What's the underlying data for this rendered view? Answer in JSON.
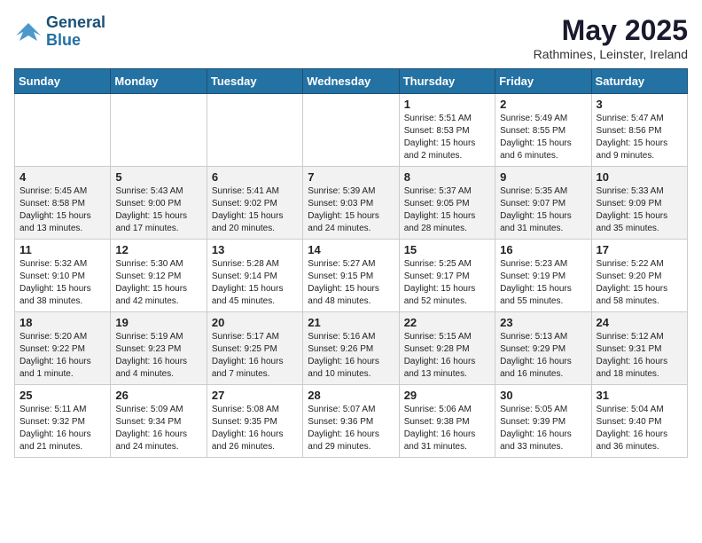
{
  "header": {
    "logo_line1": "General",
    "logo_line2": "Blue",
    "month_title": "May 2025",
    "location": "Rathmines, Leinster, Ireland"
  },
  "weekdays": [
    "Sunday",
    "Monday",
    "Tuesday",
    "Wednesday",
    "Thursday",
    "Friday",
    "Saturday"
  ],
  "weeks": [
    [
      {
        "day": "",
        "info": ""
      },
      {
        "day": "",
        "info": ""
      },
      {
        "day": "",
        "info": ""
      },
      {
        "day": "",
        "info": ""
      },
      {
        "day": "1",
        "info": "Sunrise: 5:51 AM\nSunset: 8:53 PM\nDaylight: 15 hours\nand 2 minutes."
      },
      {
        "day": "2",
        "info": "Sunrise: 5:49 AM\nSunset: 8:55 PM\nDaylight: 15 hours\nand 6 minutes."
      },
      {
        "day": "3",
        "info": "Sunrise: 5:47 AM\nSunset: 8:56 PM\nDaylight: 15 hours\nand 9 minutes."
      }
    ],
    [
      {
        "day": "4",
        "info": "Sunrise: 5:45 AM\nSunset: 8:58 PM\nDaylight: 15 hours\nand 13 minutes."
      },
      {
        "day": "5",
        "info": "Sunrise: 5:43 AM\nSunset: 9:00 PM\nDaylight: 15 hours\nand 17 minutes."
      },
      {
        "day": "6",
        "info": "Sunrise: 5:41 AM\nSunset: 9:02 PM\nDaylight: 15 hours\nand 20 minutes."
      },
      {
        "day": "7",
        "info": "Sunrise: 5:39 AM\nSunset: 9:03 PM\nDaylight: 15 hours\nand 24 minutes."
      },
      {
        "day": "8",
        "info": "Sunrise: 5:37 AM\nSunset: 9:05 PM\nDaylight: 15 hours\nand 28 minutes."
      },
      {
        "day": "9",
        "info": "Sunrise: 5:35 AM\nSunset: 9:07 PM\nDaylight: 15 hours\nand 31 minutes."
      },
      {
        "day": "10",
        "info": "Sunrise: 5:33 AM\nSunset: 9:09 PM\nDaylight: 15 hours\nand 35 minutes."
      }
    ],
    [
      {
        "day": "11",
        "info": "Sunrise: 5:32 AM\nSunset: 9:10 PM\nDaylight: 15 hours\nand 38 minutes."
      },
      {
        "day": "12",
        "info": "Sunrise: 5:30 AM\nSunset: 9:12 PM\nDaylight: 15 hours\nand 42 minutes."
      },
      {
        "day": "13",
        "info": "Sunrise: 5:28 AM\nSunset: 9:14 PM\nDaylight: 15 hours\nand 45 minutes."
      },
      {
        "day": "14",
        "info": "Sunrise: 5:27 AM\nSunset: 9:15 PM\nDaylight: 15 hours\nand 48 minutes."
      },
      {
        "day": "15",
        "info": "Sunrise: 5:25 AM\nSunset: 9:17 PM\nDaylight: 15 hours\nand 52 minutes."
      },
      {
        "day": "16",
        "info": "Sunrise: 5:23 AM\nSunset: 9:19 PM\nDaylight: 15 hours\nand 55 minutes."
      },
      {
        "day": "17",
        "info": "Sunrise: 5:22 AM\nSunset: 9:20 PM\nDaylight: 15 hours\nand 58 minutes."
      }
    ],
    [
      {
        "day": "18",
        "info": "Sunrise: 5:20 AM\nSunset: 9:22 PM\nDaylight: 16 hours\nand 1 minute."
      },
      {
        "day": "19",
        "info": "Sunrise: 5:19 AM\nSunset: 9:23 PM\nDaylight: 16 hours\nand 4 minutes."
      },
      {
        "day": "20",
        "info": "Sunrise: 5:17 AM\nSunset: 9:25 PM\nDaylight: 16 hours\nand 7 minutes."
      },
      {
        "day": "21",
        "info": "Sunrise: 5:16 AM\nSunset: 9:26 PM\nDaylight: 16 hours\nand 10 minutes."
      },
      {
        "day": "22",
        "info": "Sunrise: 5:15 AM\nSunset: 9:28 PM\nDaylight: 16 hours\nand 13 minutes."
      },
      {
        "day": "23",
        "info": "Sunrise: 5:13 AM\nSunset: 9:29 PM\nDaylight: 16 hours\nand 16 minutes."
      },
      {
        "day": "24",
        "info": "Sunrise: 5:12 AM\nSunset: 9:31 PM\nDaylight: 16 hours\nand 18 minutes."
      }
    ],
    [
      {
        "day": "25",
        "info": "Sunrise: 5:11 AM\nSunset: 9:32 PM\nDaylight: 16 hours\nand 21 minutes."
      },
      {
        "day": "26",
        "info": "Sunrise: 5:09 AM\nSunset: 9:34 PM\nDaylight: 16 hours\nand 24 minutes."
      },
      {
        "day": "27",
        "info": "Sunrise: 5:08 AM\nSunset: 9:35 PM\nDaylight: 16 hours\nand 26 minutes."
      },
      {
        "day": "28",
        "info": "Sunrise: 5:07 AM\nSunset: 9:36 PM\nDaylight: 16 hours\nand 29 minutes."
      },
      {
        "day": "29",
        "info": "Sunrise: 5:06 AM\nSunset: 9:38 PM\nDaylight: 16 hours\nand 31 minutes."
      },
      {
        "day": "30",
        "info": "Sunrise: 5:05 AM\nSunset: 9:39 PM\nDaylight: 16 hours\nand 33 minutes."
      },
      {
        "day": "31",
        "info": "Sunrise: 5:04 AM\nSunset: 9:40 PM\nDaylight: 16 hours\nand 36 minutes."
      }
    ]
  ]
}
